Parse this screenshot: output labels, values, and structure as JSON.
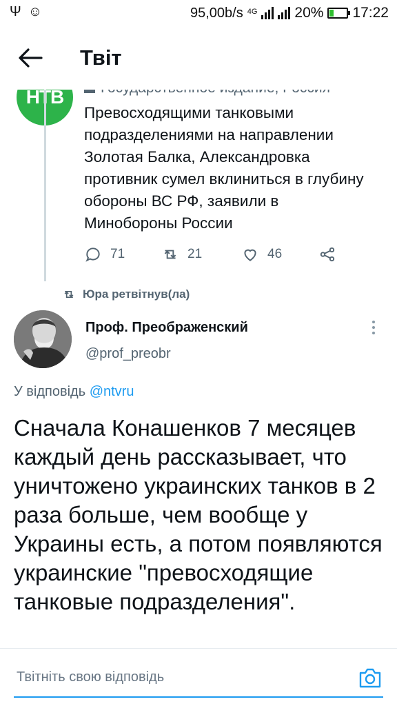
{
  "status_bar": {
    "left_icons": [
      "usb-icon",
      "message-icon"
    ],
    "speed": "95,00b/s",
    "network": "4G",
    "battery": "20%",
    "battery_level": 0.2,
    "time": "17:22"
  },
  "header": {
    "title": "Твіт"
  },
  "parent_tweet": {
    "logo_text": "НТВ",
    "label": "Государственное издание, Россия",
    "text": "Превосходящими танковыми подразделениями на направлении Золотая Балка, Александровка противник сумел вклиниться в глубину обороны ВС РФ, заявили в Минобороны России",
    "replies": "71",
    "retweets": "21",
    "likes": "46"
  },
  "retweet_label": "Юра ретвітнув(ла)",
  "tweet": {
    "author_name": "Проф. Преображенский",
    "author_handle": "@prof_preobr",
    "reply_prefix": "У відповідь",
    "reply_handle": "@ntvru",
    "text": "Сначала Конашенков 7 месяцев каждый день рассказывает, что уничтожено украинских танков в 2 раза больше, чем вообще у Украины есть, а потом появляются украинские \"превосходящие танковые подразделения\"."
  },
  "reply_bar": {
    "placeholder": "Твітніть свою відповідь"
  },
  "colors": {
    "accent": "#1d9bf0",
    "ntv_green": "#2db34a",
    "muted": "#536471"
  }
}
